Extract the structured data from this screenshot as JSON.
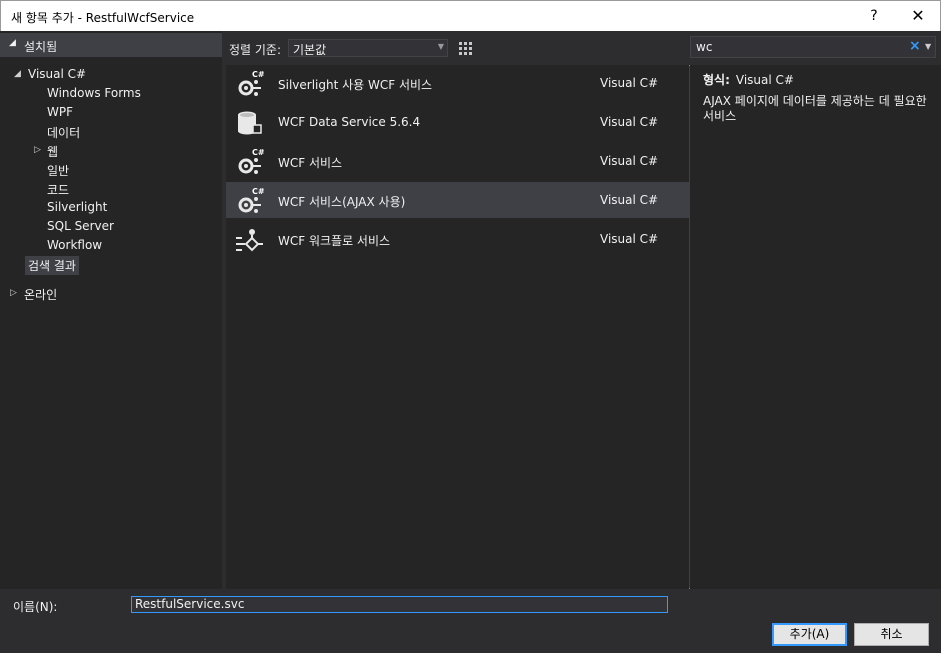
{
  "window": {
    "title": "새 항목 추가 - RestfulWcfService",
    "help": "?",
    "close": "✕"
  },
  "tree": {
    "header": "설치됨",
    "root": "Visual C#",
    "children": [
      "Windows Forms",
      "WPF",
      "데이터",
      "웹",
      "일반",
      "코드",
      "Silverlight",
      "SQL Server",
      "Workflow"
    ],
    "search_results": "검색 결과",
    "online": "온라인"
  },
  "sort": {
    "label": "정렬 기준:",
    "value": "기본값"
  },
  "items": [
    {
      "name": "Silverlight 사용 WCF 서비스",
      "type": "Visual C#",
      "icon": "wcf-csharp-icon"
    },
    {
      "name": "WCF Data Service 5.6.4",
      "type": "Visual C#",
      "icon": "database-icon"
    },
    {
      "name": "WCF 서비스",
      "type": "Visual C#",
      "icon": "wcf-csharp-icon"
    },
    {
      "name": "WCF 서비스(AJAX 사용)",
      "type": "Visual C#",
      "icon": "wcf-csharp-icon"
    },
    {
      "name": "WCF 워크플로 서비스",
      "type": "Visual C#",
      "icon": "workflow-icon"
    }
  ],
  "search": {
    "value": "wc"
  },
  "detail": {
    "type_label": "형식:",
    "type_value": "Visual C#",
    "description": "AJAX 페이지에 데이터를 제공하는 데 필요한 서비스"
  },
  "name_field": {
    "label": "이름(N):",
    "value": "RestfulService.svc"
  },
  "buttons": {
    "add": "추가(A)",
    "cancel": "취소"
  },
  "colors": {
    "accent": "#3399ff",
    "background": "#2d2d30",
    "panel": "#252526",
    "selection": "#3f3f46"
  }
}
